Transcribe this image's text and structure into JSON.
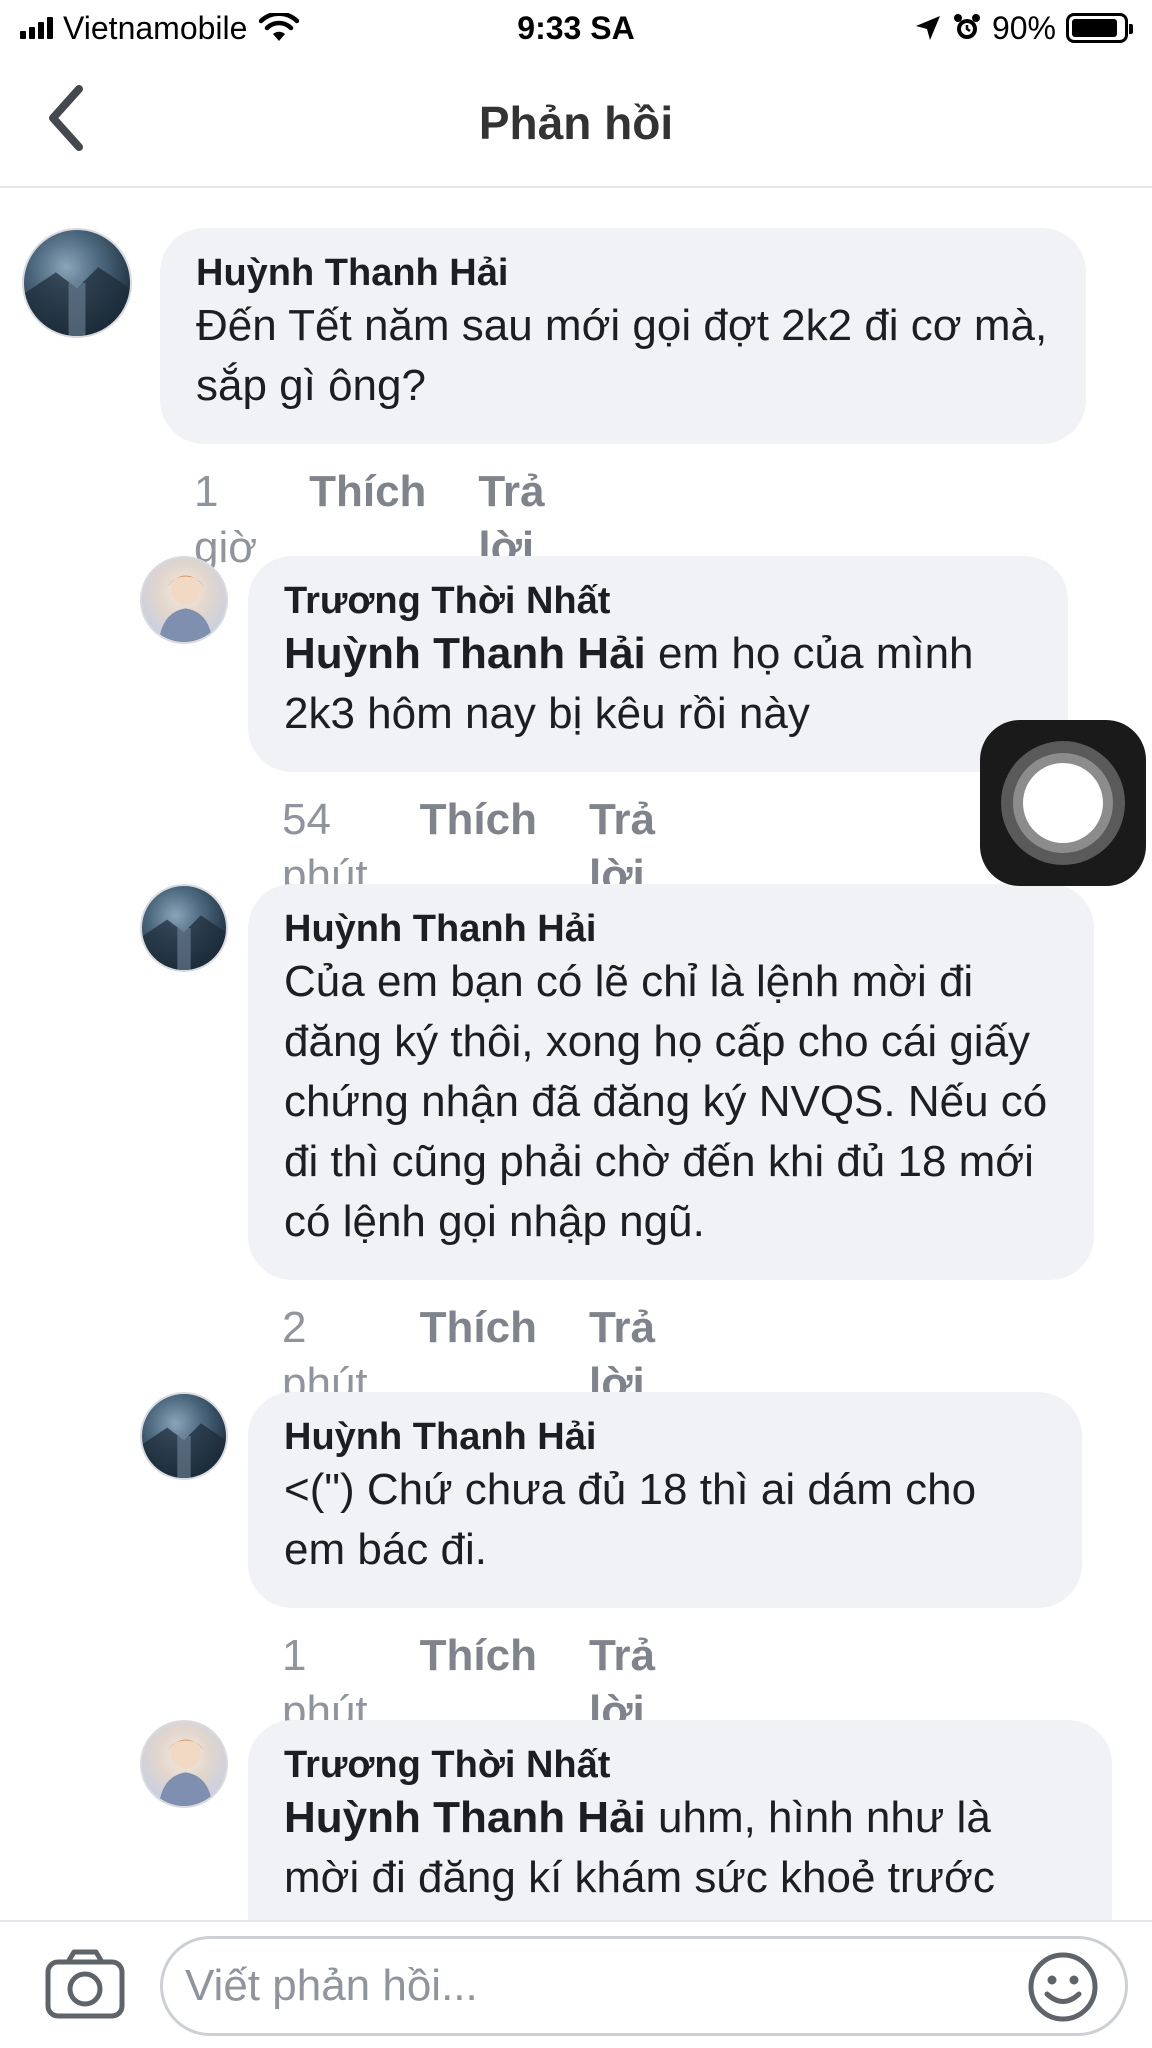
{
  "status_bar": {
    "carrier": "Vietnamobile",
    "time": "9:33 SA",
    "battery": "90%",
    "battery_level": 0.9
  },
  "header": {
    "title": "Phản hồi",
    "back_icon": "chevron-left-icon"
  },
  "comments": [
    {
      "author": "Huỳnh Thanh Hải",
      "mention": "",
      "text": "Đến Tết năm sau mới gọi đợt 2k2 đi cơ mà, sắp gì ông?",
      "time": "1 giờ",
      "like": "Thích",
      "reply": "Trả lời"
    },
    {
      "author": "Trương Thời Nhất",
      "mention": "Huỳnh Thanh Hải",
      "text": "em họ của mình 2k3 hôm nay bị kêu rồi này",
      "time": "54 phút",
      "like": "Thích",
      "reply": "Trả lời"
    },
    {
      "author": "Huỳnh Thanh Hải",
      "mention": "",
      "text": "Của em bạn có lẽ chỉ là lệnh mời đi đăng ký thôi, xong họ cấp cho cái giấy chứng nhận đã đăng ký NVQS. Nếu có đi thì cũng phải chờ đến khi đủ 18 mới có lệnh gọi nhập ngũ.",
      "time": "2 phút",
      "like": "Thích",
      "reply": "Trả lời"
    },
    {
      "author": "Huỳnh Thanh Hải",
      "mention": "",
      "text": "<(\") Chứ chưa đủ 18 thì ai dám cho em bác đi.",
      "time": "1 phút",
      "like": "Thích",
      "reply": "Trả lời"
    },
    {
      "author": "Trương Thời Nhất",
      "mention": "Huỳnh Thanh Hải",
      "text": "uhm, hình như là mời đi đăng kí khám sức khoẻ trước",
      "time": "",
      "like": "",
      "reply": ""
    }
  ],
  "composer": {
    "placeholder": "Viết phản hồi...",
    "camera_icon": "camera-icon",
    "emoji_icon": "emoji-icon"
  },
  "colors": {
    "bubble": "#f0f2f5",
    "meta_text": "#90949c",
    "divider": "#e4e6eb"
  }
}
